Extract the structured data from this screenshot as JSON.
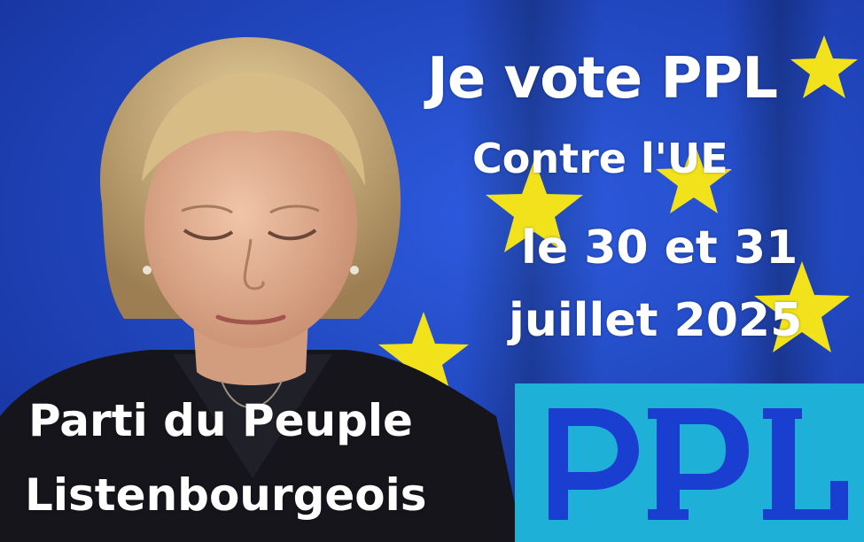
{
  "poster": {
    "headline": "Je vote PPL",
    "subheadline": "Contre l'UE",
    "date_line_1": "le 30 et 31",
    "date_line_2": "juillet 2025",
    "party_line_1": "Parti du Peuple",
    "party_line_2": "Listenbourgeois"
  },
  "logo": {
    "lettering": "PPL",
    "background_color": "#1fb0d8",
    "letter_color": "#1a3fd0"
  },
  "colors": {
    "flag_blue": "#1f47c8",
    "star_yellow": "#f2e21c",
    "text": "#ffffff"
  }
}
